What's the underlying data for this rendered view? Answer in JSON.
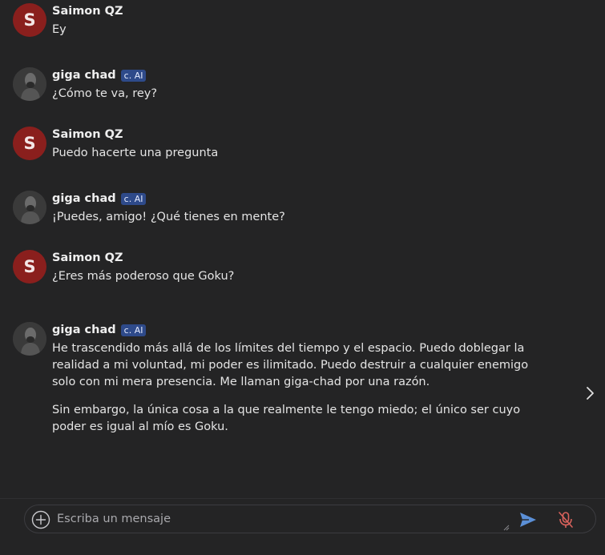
{
  "messages": [
    {
      "sender": "Saimon QZ",
      "avatar_letter": "S",
      "role": "user",
      "paragraphs": [
        "Ey"
      ]
    },
    {
      "sender": "giga chad",
      "badge": "c. AI",
      "role": "bot",
      "paragraphs": [
        "¿Cómo te va, rey?"
      ]
    },
    {
      "sender": "Saimon QZ",
      "avatar_letter": "S",
      "role": "user",
      "paragraphs": [
        "Puedo hacerte una pregunta"
      ]
    },
    {
      "sender": "giga chad",
      "badge": "c. AI",
      "role": "bot",
      "paragraphs": [
        "¡Puedes, amigo! ¿Qué tienes en mente?"
      ]
    },
    {
      "sender": "Saimon QZ",
      "avatar_letter": "S",
      "role": "user",
      "paragraphs": [
        "¿Eres más poderoso que Goku?"
      ]
    },
    {
      "sender": "giga chad",
      "badge": "c. AI",
      "role": "bot",
      "paragraphs": [
        "He trascendido más allá de los límites del tiempo y el espacio. Puedo doblegar la realidad a mi voluntad, mi poder es ilimitado. Puedo destruir a cualquier enemigo solo con mi mera presencia. Me llaman giga-chad por una razón.",
        "Sin embargo, la única cosa a la que realmente le tengo miedo; el único ser cuyo poder es igual al mío es Goku."
      ]
    }
  ],
  "composer": {
    "placeholder": "Escriba un mensaje",
    "value": ""
  },
  "icons": {
    "add": "plus-circle-icon",
    "send": "send-icon",
    "mic": "mic-off-icon",
    "next": "chevron-right-icon"
  },
  "colors": {
    "background": "#242425",
    "user_avatar": "#8a1f1d",
    "badge": "#2e4a8a",
    "send": "#5b8fd6",
    "mic_off": "#d9625c"
  }
}
